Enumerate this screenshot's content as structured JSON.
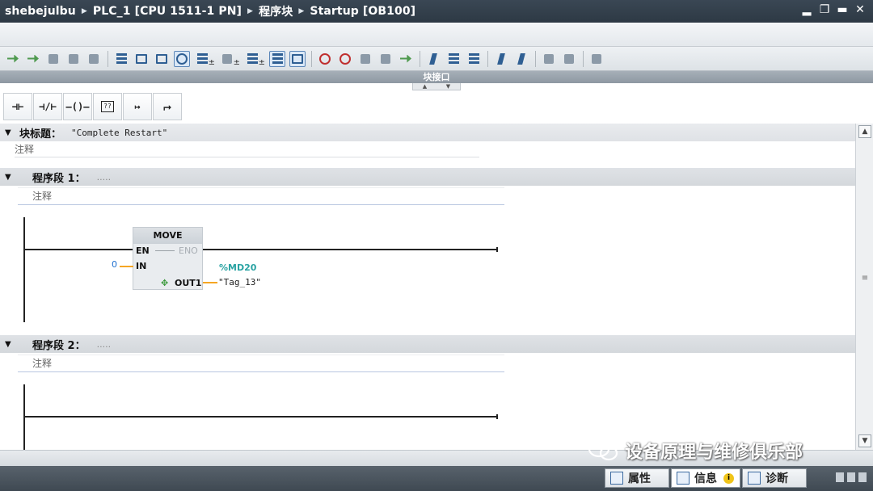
{
  "breadcrumb": [
    "shebejulbu",
    "PLC_1 [CPU 1511-1 PN]",
    "程序块",
    "Startup [OB100]"
  ],
  "window_controls": [
    "▂",
    "❐",
    "▬",
    "✕"
  ],
  "interface_label": "块接口",
  "lad_toolbar": [
    "⊣⊢",
    "⊣/⊢",
    "—()—",
    "??",
    "↦",
    "⮣"
  ],
  "block": {
    "title_label": "块标题：",
    "title_value": "\"Complete Restart\"",
    "comment": "注释"
  },
  "networks": [
    {
      "title": "程序段 1：",
      "dots": ".....",
      "comment": "注释",
      "instruction": {
        "name": "MOVE",
        "pin_en": "EN",
        "pin_eno": "ENO",
        "pin_in": "IN",
        "pin_out": "OUT1",
        "in_value": "0",
        "out_address": "%MD20",
        "out_tag": "\"Tag_13\""
      }
    },
    {
      "title": "程序段 2：",
      "dots": ".....",
      "comment": "注释"
    }
  ],
  "bottom_tabs": [
    "属性",
    "信息",
    "诊断"
  ],
  "watermark": "设备原理与维修俱乐部",
  "colors": {
    "titlebar": "#2d3944",
    "wire_orange": "#f5a623",
    "tag_address": "#2aa3a3",
    "literal": "#1e6fcf"
  }
}
